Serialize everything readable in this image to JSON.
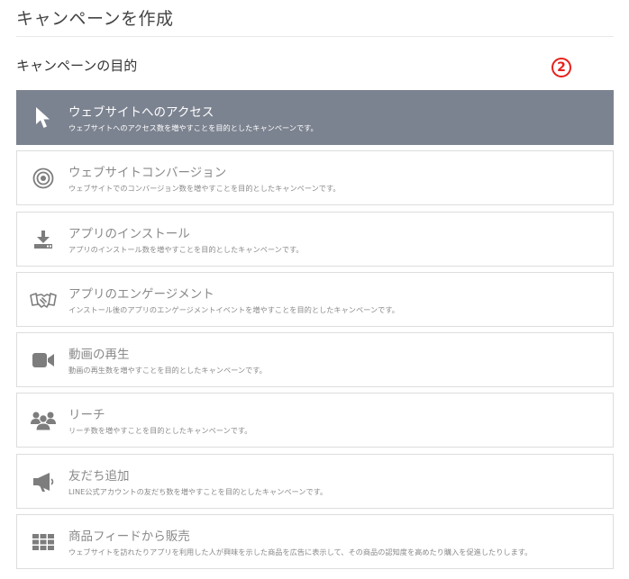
{
  "header": {
    "title": "キャンペーンを作成"
  },
  "section": {
    "title": "キャンペーンの目的",
    "step_badge": "2"
  },
  "objectives": [
    {
      "label": "ウェブサイトへのアクセス",
      "description": "ウェブサイトへのアクセス数を増やすことを目的としたキャンペーンです。",
      "icon": "cursor-icon",
      "selected": true
    },
    {
      "label": "ウェブサイトコンバージョン",
      "description": "ウェブサイトでのコンバージョン数を増やすことを目的としたキャンペーンです。",
      "icon": "target-icon",
      "selected": false
    },
    {
      "label": "アプリのインストール",
      "description": "アプリのインストール数を増やすことを目的としたキャンペーンです。",
      "icon": "download-icon",
      "selected": false
    },
    {
      "label": "アプリのエンゲージメント",
      "description": "インストール後のアプリのエンゲージメントイベントを増やすことを目的としたキャンペーンです。",
      "icon": "handshake-icon",
      "selected": false
    },
    {
      "label": "動画の再生",
      "description": "動画の再生数を増やすことを目的としたキャンペーンです。",
      "icon": "video-camera-icon",
      "selected": false
    },
    {
      "label": "リーチ",
      "description": "リーチ数を増やすことを目的としたキャンペーンです。",
      "icon": "people-icon",
      "selected": false
    },
    {
      "label": "友だち追加",
      "description": "LINE公式アカウントの友だち数を増やすことを目的としたキャンペーンです。",
      "icon": "megaphone-icon",
      "selected": false
    },
    {
      "label": "商品フィードから販売",
      "description": "ウェブサイトを訪れたりアプリを利用した人が興味を示した商品を広告に表示して、その商品の認知度を高めたり購入を促進したりします。",
      "icon": "grid-icon",
      "selected": false
    }
  ],
  "colors": {
    "selected_background": "#7c8390",
    "icon_gray": "#7d7d7d",
    "text_gray": "#8a8a8a",
    "step_badge": "#e8201a"
  }
}
